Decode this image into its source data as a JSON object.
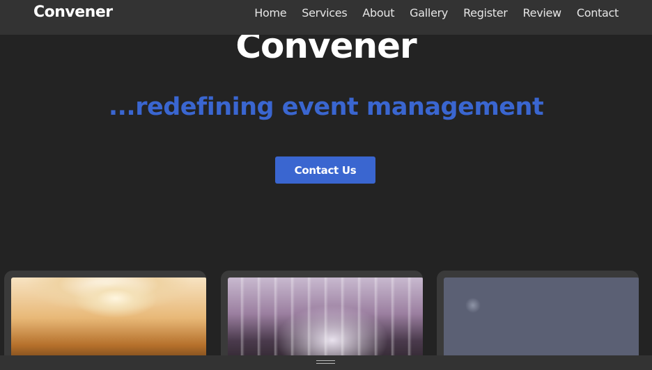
{
  "navbar": {
    "brand": "Convener",
    "links": [
      "Home",
      "Services",
      "About",
      "Gallery",
      "Register",
      "Review",
      "Contact"
    ]
  },
  "hero": {
    "title": "Convener",
    "subtitle": "...redefining event management",
    "cta_label": "Contact Us"
  },
  "colors": {
    "accent": "#3a66d0",
    "background": "#232323",
    "navbar": "#333333",
    "card": "#3a3a3a"
  },
  "cards": [
    {
      "image": "ballroom-photo"
    },
    {
      "image": "banquet-hall-photo"
    },
    {
      "image": "balloon-arch-photo"
    }
  ],
  "icons": {
    "bottom_bar": "drag-handle-icon"
  }
}
